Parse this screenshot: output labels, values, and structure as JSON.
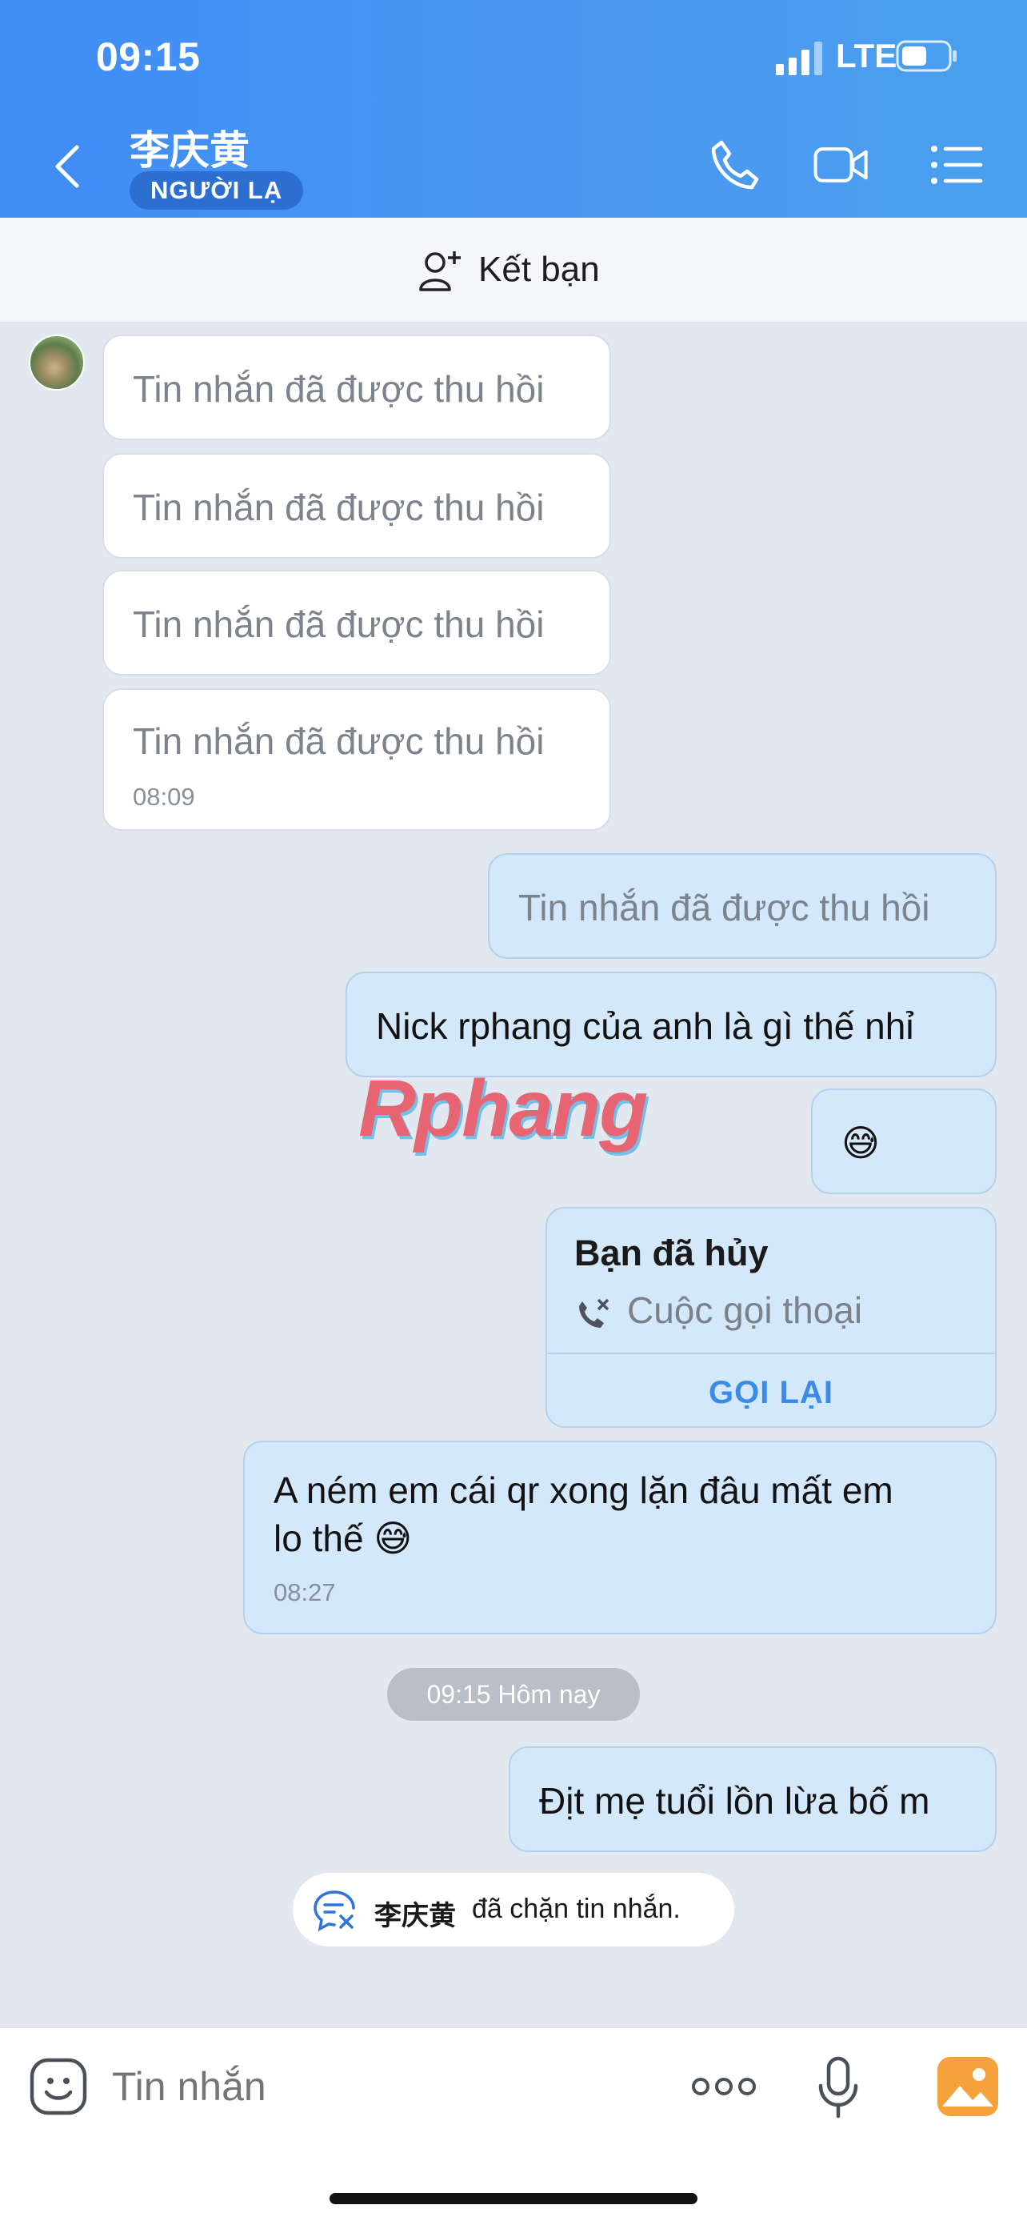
{
  "status_bar": {
    "time": "09:15",
    "network": "LTE"
  },
  "header": {
    "contact_name": "李庆黄",
    "badge": "NGƯỜI LẠ"
  },
  "friend_bar": {
    "label": "Kết bạn"
  },
  "messages": {
    "in_1": "Tin nhắn đã được thu hồi",
    "in_2": "Tin nhắn đã được thu hồi",
    "in_3": "Tin nhắn đã được thu hồi",
    "in_4": "Tin nhắn đã được thu hồi",
    "in_4_time": "08:09",
    "out_1": "Tin nhắn đã được thu hồi",
    "out_2": "Nick rphang của anh là gì thế nhỉ",
    "out_3": "😅",
    "call_title": "Bạn đã hủy",
    "call_subtitle": "Cuộc gọi thoại",
    "call_action": "GỌI LẠI",
    "out_5_line1": "A ném em cái qr xong lặn đâu mất em",
    "out_5_line2": "lo thế 😅",
    "out_5_time": "08:27",
    "divider_time": "09:15 Hôm nay",
    "out_6": "Địt mẹ tuổi lồn lừa bố m"
  },
  "system_notice": {
    "name": "李庆黄",
    "text": "đã chặn tin nhắn."
  },
  "watermark": "Rphang",
  "composer": {
    "placeholder": "Tin nhắn"
  },
  "colors": {
    "header": "#4a98f1",
    "outgoing_bubble": "#d4e8fb",
    "accent": "#3a8ae8",
    "background": "#e2e8ef"
  }
}
